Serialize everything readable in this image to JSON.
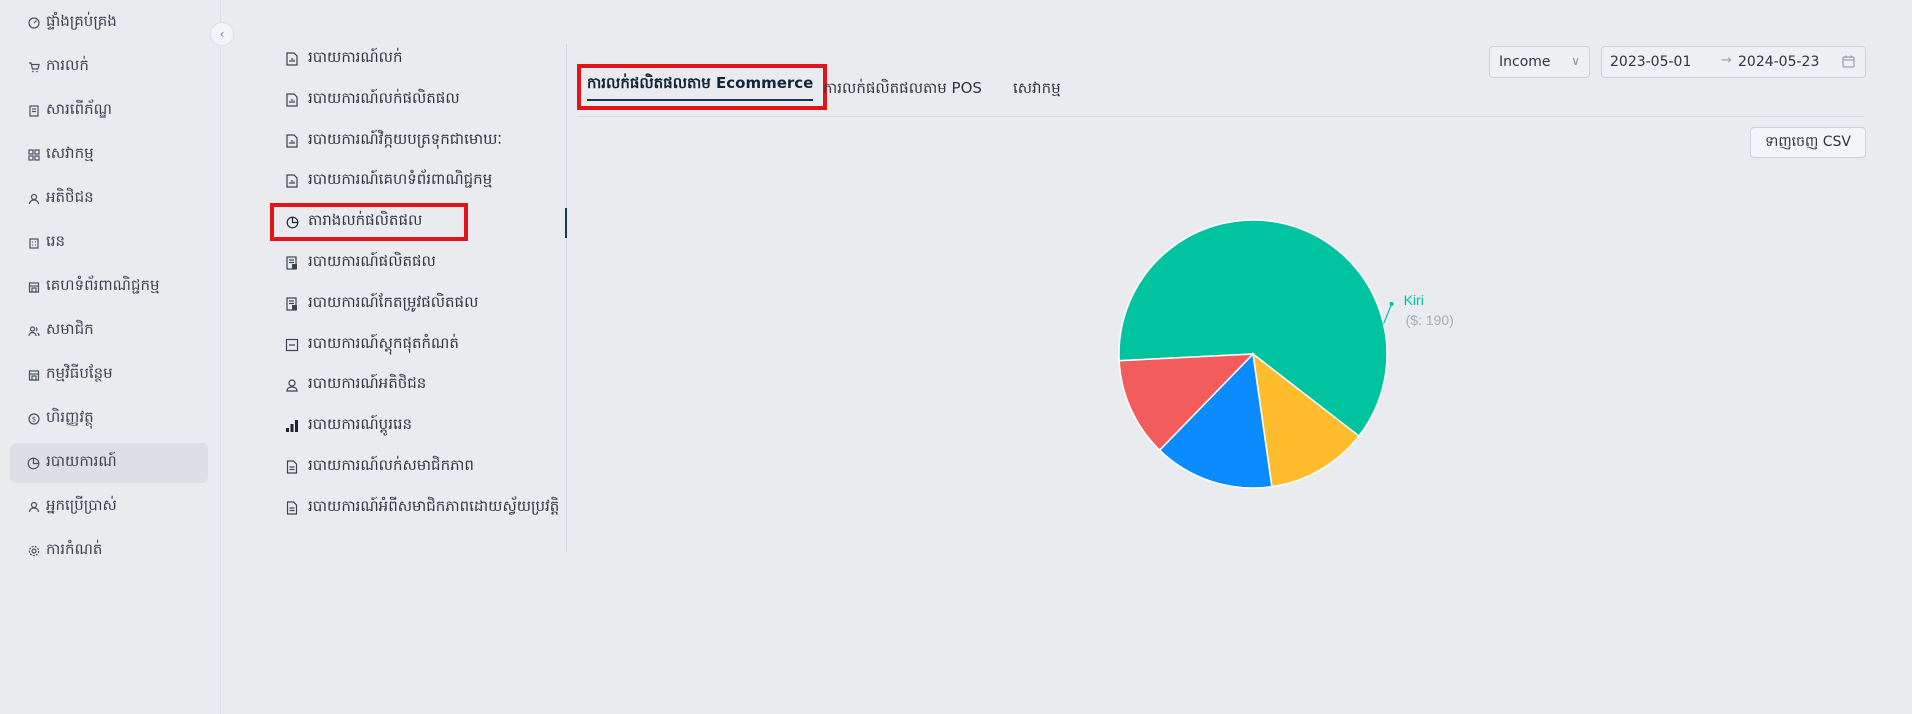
{
  "sidebar": {
    "items": [
      {
        "label": "ផ្ទាំងគ្រប់គ្រង",
        "icon": "dashboard-icon"
      },
      {
        "label": "ការលក់",
        "icon": "cart-icon"
      },
      {
        "label": "សារពើភ័ណ្ឌ",
        "icon": "inventory-icon"
      },
      {
        "label": "សេវាកម្ម",
        "icon": "services-grid-icon"
      },
      {
        "label": "អតិថិជន",
        "icon": "customer-icon"
      },
      {
        "label": "រេន",
        "icon": "building-icon"
      },
      {
        "label": "គេហទំព័រពាណិជ្ជកម្ម",
        "icon": "store-icon"
      },
      {
        "label": "សមាជិក",
        "icon": "members-icon"
      },
      {
        "label": "កម្មវិធីបន្ថែម",
        "icon": "addon-icon"
      },
      {
        "label": "ហិរញ្ញវត្ថុ",
        "icon": "dollar-icon"
      },
      {
        "label": "របាយការណ៍",
        "icon": "report-pie-icon",
        "active": true
      },
      {
        "label": "អ្នកប្រើប្រាស់",
        "icon": "user-icon"
      },
      {
        "label": "ការកំណត់",
        "icon": "gear-icon"
      }
    ]
  },
  "reports": {
    "items": [
      {
        "label": "របាយការណ៍លក់",
        "icon": "bar-report-icon"
      },
      {
        "label": "របាយការណ៍លក់ផលិតផល",
        "icon": "bar-report-icon"
      },
      {
        "label": "របាយការណ៍វិក្កយបត្រទុកជាមោឃៈ",
        "icon": "bar-report-icon"
      },
      {
        "label": "របាយការណ៍គេហទំព័រពាណិជ្ជកម្ម",
        "icon": "bar-report-icon"
      },
      {
        "label": "តារាងលក់ផលិតផល",
        "icon": "pie-chart-icon",
        "active": true
      },
      {
        "label": "របាយការណ៍ផលិតផល",
        "icon": "product-report-icon"
      },
      {
        "label": "របាយការណ៍កែតម្រូវផលិតផល",
        "icon": "product-report-icon"
      },
      {
        "label": "របាយការណ៍ស្តុកផុតកំណត់",
        "icon": "minus-box-icon"
      },
      {
        "label": "របាយការណ៍អតិថិជន",
        "icon": "person-icon"
      },
      {
        "label": "របាយការណ៍ប្តូររេន",
        "icon": "signal-bars-icon"
      },
      {
        "label": "របាយការណ៍លក់សមាជិកភាព",
        "icon": "document-icon"
      },
      {
        "label": "របាយការណ៍អំពីសមាជិកភាពដោយស្វ័យប្រវត្តិ",
        "icon": "document-icon"
      }
    ]
  },
  "tabs": [
    {
      "label": "ការលក់ផលិតផលតាម Ecommerce",
      "active": true
    },
    {
      "label": "ការលក់ផលិតផលតាម POS"
    },
    {
      "label": "សេវាកម្ម"
    }
  ],
  "filters": {
    "type_value": "Income",
    "date_start": "2023-05-01",
    "date_end": "2024-05-23"
  },
  "export_label": "ទាញចេញ CSV",
  "colors": {
    "accent": "#0e3b5c",
    "highlight": "#e3141c"
  },
  "chart_data": {
    "type": "pie",
    "slices": [
      {
        "name": "Kiri",
        "value": 190,
        "color": "#00c3a0",
        "label": "Kiri",
        "sublabel": "($: 190)"
      },
      {
        "name": "",
        "value": 38,
        "color": "#ffbd2e"
      },
      {
        "name": "",
        "value": 45,
        "color": "#0a8cff"
      },
      {
        "name": "",
        "value": 37,
        "color": "#f25c5c"
      }
    ]
  }
}
